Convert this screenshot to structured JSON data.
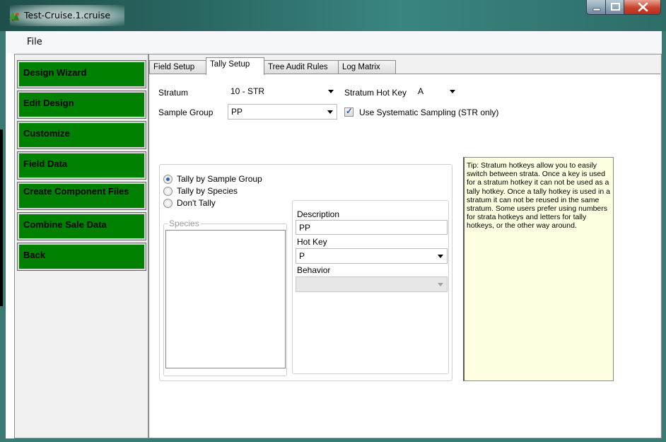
{
  "window": {
    "title": "Test-Cruise.1.cruise",
    "icons": [
      "tree-app-icon"
    ],
    "caption_buttons": [
      "minimize",
      "maximize",
      "close"
    ]
  },
  "menu": {
    "items": [
      "File"
    ]
  },
  "sidebar": {
    "accent_color": "#008000",
    "items": [
      "Design Wizard",
      "Edit Design",
      "Customize",
      "Field Data",
      "Create Component Files",
      "Combine Sale Data",
      "Back"
    ]
  },
  "tabs": [
    {
      "label": "Field Setup"
    },
    {
      "label": "Tally Setup",
      "active": true
    },
    {
      "label": "Tree Audit Rules"
    },
    {
      "label": "Log Matrix"
    }
  ],
  "tally_setup": {
    "stratum_label": "Stratum",
    "stratum_value": "10 - STR",
    "stratum_hotkey_label": "Stratum Hot Key",
    "stratum_hotkey_value": "A",
    "sample_group_label": "Sample Group",
    "sample_group_value": "PP",
    "systematic_label": "Use Systematic Sampling (STR only)",
    "systematic_checked": true,
    "tally_options": [
      {
        "label": "Tally by Sample Group",
        "selected": true
      },
      {
        "label": "Tally by Species",
        "selected": false
      },
      {
        "label": "Don't Tally",
        "selected": false
      }
    ],
    "species_label": "Species",
    "description_label": "Description",
    "description_value": "PP",
    "hotkey_label": "Hot Key",
    "hotkey_value": "P",
    "behavior_label": "Behavior",
    "behavior_value": ""
  },
  "tip": {
    "text": "Tip: Stratum hotkeys allow you to easily switch between strata. Once a key is used for a stratum hotkey it can not be used as a tally hotkey. Once a tally hotkey is used in a stratum it can not be reused in the same stratum. Some users prefer using numbers for strata hotkeys and letters for tally hotkeys, or the other way around."
  }
}
